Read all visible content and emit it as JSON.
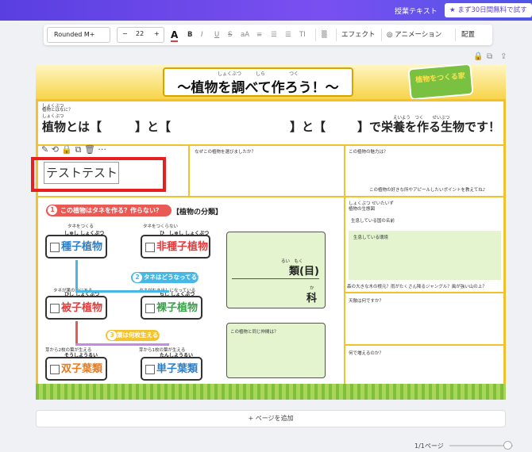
{
  "topbar": {
    "print_text": "授業テキスト",
    "trial_button": "★ まず30日間無料で試す"
  },
  "toolbar": {
    "font": "Rounded M+",
    "minus": "−",
    "size": "22",
    "plus": "+",
    "font_color": "A",
    "bold": "B",
    "italic": "I",
    "underline": "U",
    "strike": "S",
    "case": "aA",
    "align": "≡",
    "list": "☰",
    "spacing": "☰",
    "vertical": "TI",
    "transparency": "▒",
    "effect": "エフェクト",
    "animation": "◎ アニメーション",
    "position": "配置"
  },
  "page_icons": {
    "lock": "🔒",
    "copy": "⧉",
    "share": "⇪"
  },
  "canvas": {
    "title_ruby": "しょくぶつ　　　しら　　　　　つく",
    "title": "〜植物を調べて作ろう！〜",
    "badge": "植物をつくる家",
    "q_intro_ruby": "しょくぶつ",
    "q_intro": "植物とはなに？",
    "defn_ruby": "しょくぶつ",
    "defn_prefix": "植物とは【",
    "defn_mid1": "】と【",
    "defn_mid2": "】と【",
    "defn_suffix": "】で栄養を作る生物です！",
    "defn_suffix_ruby": "えいよう　つく　　せいぶつ",
    "edit_tools": "✎ ⟲ 🔒 ⧉ 🗑 ···",
    "test_text": "テストテスト",
    "why_chose": "なぜこの植物を選びましたか？",
    "charm": "この植物の魅力は？",
    "charm_hint": "この植物の好きな所やアピールしたいポイントを教えてね♪",
    "q1": "この植物はタネを作る？作らない？",
    "q1_num": "1",
    "classification": "【植物の分類】",
    "makes_seed": "タネをつくる",
    "no_seed": "タネをつくらない",
    "seed_plant": "種子植物",
    "seed_plant_ruby": "しゅし しょくぶつ",
    "nonseed_plant": "非種子植物",
    "nonseed_plant_ruby": "ひ　しゅし しょくぶつ",
    "q2": "タネはどうなってる？",
    "q2_num": "2",
    "seed_inside": "タネが果の中にある",
    "seed_exposed": "タネがむき出しになっている",
    "angio": "被子植物",
    "angio_ruby": "ひし しょくぶつ",
    "gymno": "裸子植物",
    "gymno_ruby": "らし しょくぶつ",
    "q3": "葉は何枚生える？",
    "q3_num": "3",
    "two_leaves": "芽から2枚の葉が生える",
    "one_leaf": "芽から1枚の葉が生える",
    "dicot": "双子葉類",
    "dicot_ruby": "そうしようるい",
    "monocot": "単子葉類",
    "monocot_ruby": "たんしようるい",
    "family_label": "類(目)",
    "family_ruby": "るい　もく",
    "ka_label": "科",
    "ka_ruby": "か",
    "same_group": "この植物と同じ仲間は？",
    "eco_title": "植物の生態図",
    "eco_ruby": "しょくぶつ せいたいず",
    "place_name": "生息している国の名前",
    "place_env": "生息している環境",
    "forest_q": "森の大きな木の根元？雨がたくさん降るジャングル？風が強い山の上？",
    "enemy": "天敵は何ですか？",
    "food": "何で増えるのか？"
  },
  "add_page": "+ ページを追加",
  "pager": "1/1ページ"
}
